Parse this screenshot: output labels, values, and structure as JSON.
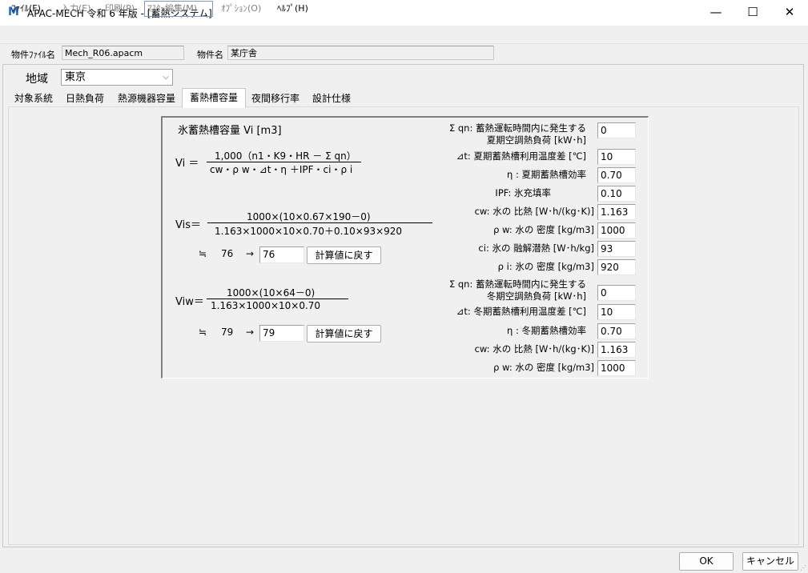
{
  "window": {
    "app_icon": "M",
    "title": "APAC-MECH 令和 6 年版 - [蓄熱システム]",
    "min_glyph": "—",
    "max_glyph": "☐",
    "close_glyph": "✕"
  },
  "menu": [
    {
      "label": "ﾌｧｲﾙ(F)",
      "state": "enabled"
    },
    {
      "label": "入力(E)",
      "state": "disabled"
    },
    {
      "label": "印刷(P)",
      "state": "disabled"
    },
    {
      "label": "ﾏｽﾀｰ編集(M)",
      "state": "disabled"
    },
    {
      "label": "ｵﾌﾟｼｮﾝ(O)",
      "state": "disabled"
    },
    {
      "label": "ﾍﾙﾌﾟ(H)",
      "state": "enabled"
    }
  ],
  "info": {
    "file_label": "物件ﾌｧｲﾙ名",
    "file_value": "Mech_R06.apacm",
    "name_label": "物件名",
    "name_value": "某庁舎"
  },
  "region": {
    "label": "地域",
    "value": "東京",
    "chevron": "⌵"
  },
  "tabs": [
    {
      "label": "対象系統",
      "active": false
    },
    {
      "label": "日熱負荷",
      "active": false
    },
    {
      "label": "熱源機器容量",
      "active": false
    },
    {
      "label": "蓄熱槽容量",
      "active": true
    },
    {
      "label": "夜間移行率",
      "active": false
    },
    {
      "label": "設計仕様",
      "active": false
    }
  ],
  "calc": {
    "title": "氷蓄熱槽容量 Vi [m3]",
    "vi_label": "Vi ＝",
    "vi_numerator": "1,000（n1・K9・HR － Σ qn）",
    "vi_denominator": "cw・ρ w・⊿t・η ＋IPF・ci・ρ i",
    "vis_label": "Vis＝",
    "vis_numerator": "1000×(10×0.67×190－0)",
    "vis_denominator": "1.163×1000×10×0.70＋0.10×93×920",
    "vis_approx": "≒",
    "vis_result": "76",
    "vis_arrow": "→",
    "vis_input": "76",
    "vis_button": "計算値に戻す",
    "viw_label": "Viw＝",
    "viw_numerator": "1000×(10×64－0)",
    "viw_denominator": "1.163×1000×10×0.70",
    "viw_approx": "≒",
    "viw_result": "79",
    "viw_arrow": "→",
    "viw_input": "79",
    "viw_button": "計算値に戻す"
  },
  "params_summer": [
    {
      "label": "Σ qn: 蓄熱運転時間内に発生する",
      "label2": "夏期空調熱負荷 [kW･h]",
      "value": "0"
    },
    {
      "label": "⊿t: 夏期蓄熱槽利用温度差 [℃]",
      "value": "10"
    },
    {
      "label": "η : 夏期蓄熱槽効率",
      "value": "0.70"
    },
    {
      "label": "IPF: 氷充填率",
      "value": "0.10"
    },
    {
      "label": "cw: 水の 比熱 [W･h/(kg･K)]",
      "value": "1.163"
    },
    {
      "label": "ρ w: 水の 密度 [kg/m3]",
      "value": "1000"
    },
    {
      "label": "ci: 氷の 融解潜熱 [W･h/kg]",
      "value": "93"
    },
    {
      "label": "ρ i: 氷の 密度 [kg/m3]",
      "value": "920"
    }
  ],
  "params_winter": [
    {
      "label": "Σ qn: 蓄熱運転時間内に発生する",
      "label2": "冬期空調熱負荷 [kW･h]",
      "value": "0"
    },
    {
      "label": "⊿t: 冬期蓄熱槽利用温度差 [℃]",
      "value": "10"
    },
    {
      "label": "η : 冬期蓄熱槽効率",
      "value": "0.70"
    },
    {
      "label": "cw: 水の 比熱 [W･h/(kg･K)]",
      "value": "1.163"
    },
    {
      "label": "ρ w: 水の 密度 [kg/m3]",
      "value": "1000"
    }
  ],
  "footer": {
    "ok": "OK",
    "cancel": "キャンセル",
    "grip": "⋰"
  }
}
